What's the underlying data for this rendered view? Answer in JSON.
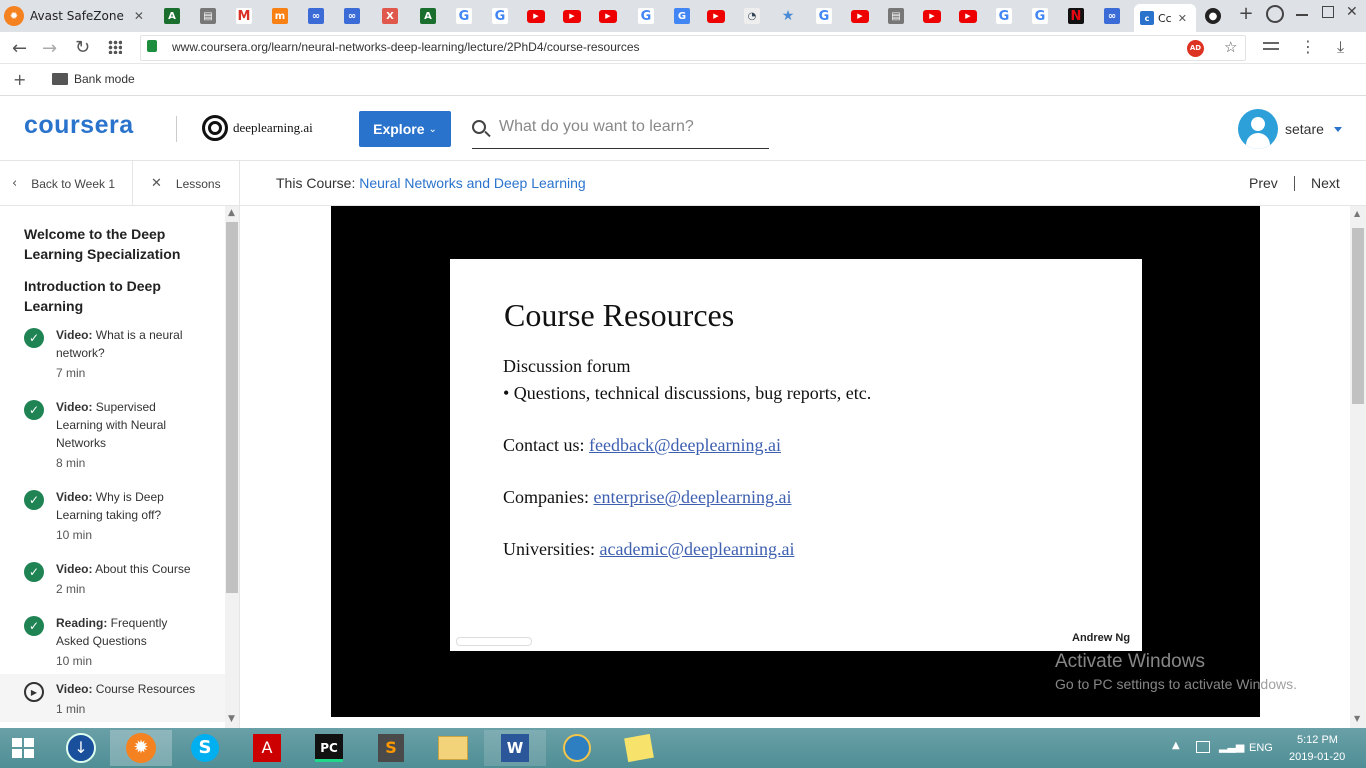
{
  "browser": {
    "first_tab_label": "Avast SafeZone",
    "active_tab_label": "Cc",
    "url": "www.coursera.org/learn/neural-networks-deep-learning/lecture/2PhD4/course-resources",
    "adblock_badge": "AD",
    "bookmark_folder": "Bank mode"
  },
  "header": {
    "logo": "coursera",
    "partner": "deeplearning.ai",
    "explore_label": "Explore",
    "search_placeholder": "What do you want to learn?",
    "username": "setare"
  },
  "subnav": {
    "back_label": "Back to Week 1",
    "lessons_label": "Lessons",
    "course_prefix": "This Course:",
    "course_name": "Neural Networks and Deep Learning",
    "prev_label": "Prev",
    "next_label": "Next"
  },
  "sidebar": {
    "section1_title": "Welcome to the Deep Learning Specialization",
    "section2_title": "Introduction to Deep Learning",
    "items": [
      {
        "type": "Video:",
        "title_lines": [
          "What is a neural",
          "network?"
        ],
        "time": "7 min",
        "done": true
      },
      {
        "type": "Video:",
        "title_lines": [
          "Supervised",
          "Learning with Neural",
          "Networks"
        ],
        "time": "8 min",
        "done": true
      },
      {
        "type": "Video:",
        "title_lines": [
          "Why is Deep",
          "Learning taking off?"
        ],
        "time": "10 min",
        "done": true
      },
      {
        "type": "Video:",
        "title_lines": [
          "About this Course"
        ],
        "time": "2 min",
        "done": true
      },
      {
        "type": "Reading:",
        "title_lines": [
          "Frequently",
          "Asked Questions"
        ],
        "time": "10 min",
        "done": true
      },
      {
        "type": "Video:",
        "title_lines": [
          "Course Resources"
        ],
        "time": "1 min",
        "done": false
      }
    ]
  },
  "slide": {
    "title": "Course Resources",
    "forum_heading": "Discussion forum",
    "forum_bullet": "• Questions, technical discussions, bug reports, etc.",
    "contact_label": "Contact us:",
    "contact_email": "feedback@deeplearning.ai",
    "companies_label": "Companies:",
    "companies_email": "enterprise@deeplearning.ai",
    "universities_label": "Universities:",
    "universities_email": "academic@deeplearning.ai",
    "author": "Andrew Ng"
  },
  "watermark": {
    "line1": "Activate Windows",
    "line2": "Go to PC settings to activate Windows."
  },
  "taskbar": {
    "lang": "ENG",
    "time": "5:12 PM",
    "date": "2019-01-20"
  },
  "colors": {
    "coursera_blue": "#2a73cc",
    "explore_blue": "#2a73cc",
    "check_green": "#1f8354",
    "link_blue": "#3d5fb0"
  }
}
